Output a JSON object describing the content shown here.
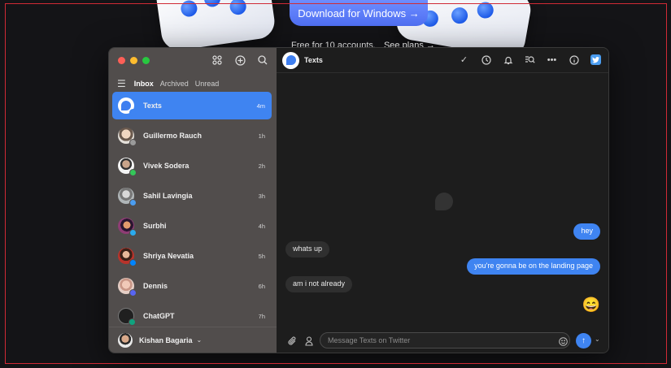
{
  "hero": {
    "download_label": "Download for Windows →",
    "free_text": "Free for 10 accounts.",
    "plans_link": "See plans →"
  },
  "sidebar": {
    "filters": [
      "Inbox",
      "Archived",
      "Unread"
    ],
    "conversations": [
      {
        "name": "Texts",
        "time": "4m",
        "avatar_color": "#ffffff",
        "badge_color": "#3f84f1"
      },
      {
        "name": "Guillermo Rauch",
        "time": "1h",
        "avatar_color": "#d8d0c6",
        "badge_color": "#9a9a9a"
      },
      {
        "name": "Vivek Sodera",
        "time": "2h",
        "avatar_color": "#e6e6e6",
        "badge_color": "#34c759"
      },
      {
        "name": "Sahil Lavingia",
        "time": "3h",
        "avatar_color": "#9fa6a8",
        "badge_color": "#4b9df0"
      },
      {
        "name": "Surbhi",
        "time": "4h",
        "avatar_color": "#5b2b6b",
        "badge_color": "#2aabee"
      },
      {
        "name": "Shriya Nevatia",
        "time": "5h",
        "avatar_color": "#c0392b",
        "badge_color": "#0084ff"
      },
      {
        "name": "Dennis",
        "time": "6h",
        "avatar_color": "#d7b5a8",
        "badge_color": "#5865f2"
      },
      {
        "name": "ChatGPT",
        "time": "7h",
        "avatar_color": "#202020",
        "badge_color": "#10a37f"
      }
    ],
    "account_name": "Kishan Bagaria"
  },
  "chat": {
    "title": "Texts",
    "messages": [
      {
        "dir": "out",
        "text": "hey"
      },
      {
        "dir": "in",
        "text": "whats up"
      },
      {
        "dir": "out",
        "text": "you're gonna be on the landing page"
      },
      {
        "dir": "in",
        "text": "am i not already"
      },
      {
        "dir": "out",
        "text": "😄"
      }
    ],
    "composer_placeholder": "Message Texts on Twitter"
  }
}
